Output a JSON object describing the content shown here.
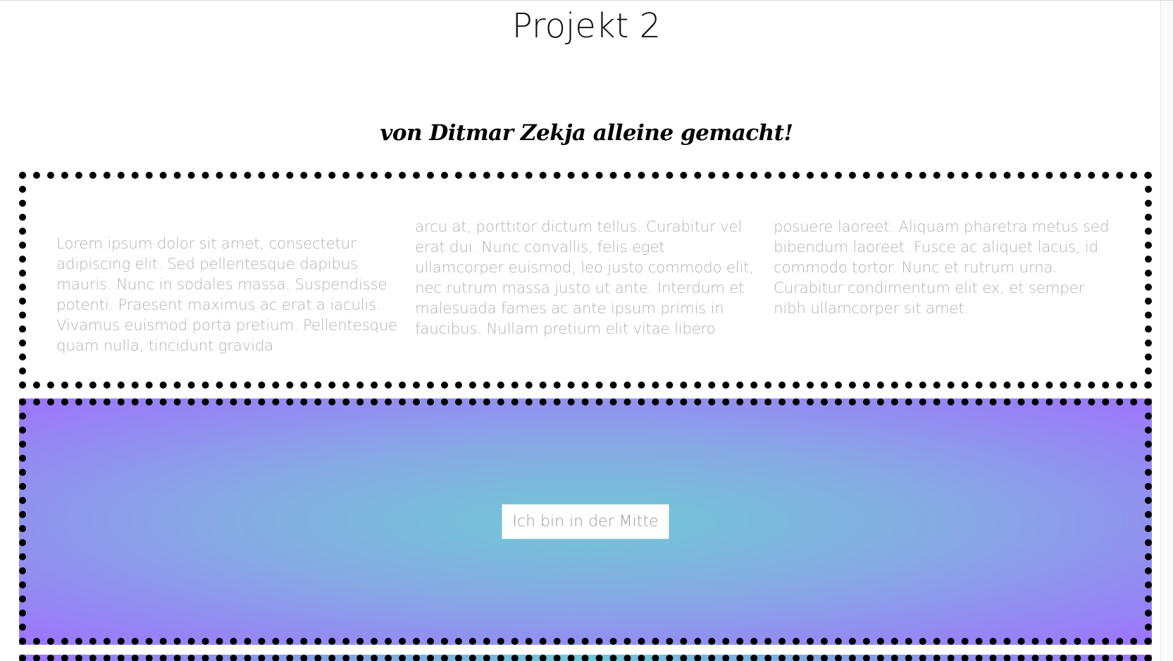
{
  "page": {
    "title": "Projekt 2",
    "subtitle": "von Ditmar Zekja alleine gemacht!"
  },
  "columns": [
    {
      "text": "Lorem ipsum dolor sit amet, consectetur adipiscing elit. Sed pellentesque dapibus mauris. Nunc in sodales massa. Suspendisse potenti. Praesent maximus ac erat a iaculis. Vivamus euismod porta pretium. Pellentesque quam nulla, tincidunt gravida"
    },
    {
      "text": "arcu at, porttitor dictum tellus. Curabitur vel erat dui. Nunc convallis, felis eget ullamcorper euismod, leo justo commodo elit, nec rutrum massa justo ut ante. Interdum et malesuada fames ac ante ipsum primis in faucibus. Nullam pretium elit vitae libero"
    },
    {
      "text": "posuere laoreet. Aliquam pharetra metus sed bibendum laoreet. Fusce ac aliquet lacus, id commodo tortor. Nunc et rutrum urna. Curabitur condimentum elit ex, et semper nibh ullamcorper sit amet."
    }
  ],
  "center_box": {
    "label": "Ich bin in der Mitte"
  },
  "colors": {
    "gradient_center": "#72c8d6",
    "gradient_edge": "#9c77fb",
    "border": "#000000",
    "body_text": "#b2b2b2"
  }
}
